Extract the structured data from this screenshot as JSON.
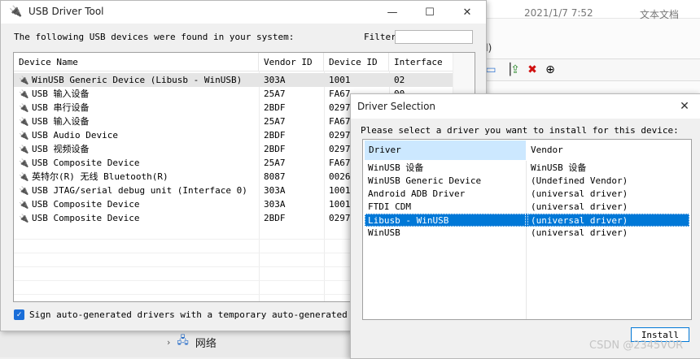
{
  "background": {
    "date_text": "2021/1/7 7:52",
    "type_text": "文本文档",
    "paren_text": "d)",
    "nav_item_label": "网络"
  },
  "usb_tool": {
    "title": "USB Driver Tool",
    "info_text": "The following USB devices were found in your system:",
    "filter_label": "Filter",
    "filter_value": "",
    "columns": [
      "Device Name",
      "Vendor ID",
      "Device ID",
      "Interface"
    ],
    "devices": [
      {
        "name": "WinUSB Generic Device (Libusb - WinUSB)",
        "vendor": "303A",
        "device": "1001",
        "interface": "02",
        "selected": true
      },
      {
        "name": "USB 输入设备",
        "vendor": "25A7",
        "device": "FA67",
        "interface": "00"
      },
      {
        "name": "USB 串行设备",
        "vendor": "2BDF",
        "device": "0297",
        "interface": ""
      },
      {
        "name": "USB 输入设备",
        "vendor": "25A7",
        "device": "FA67",
        "interface": ""
      },
      {
        "name": "USB Audio Device",
        "vendor": "2BDF",
        "device": "0297",
        "interface": ""
      },
      {
        "name": "USB 视频设备",
        "vendor": "2BDF",
        "device": "0297",
        "interface": ""
      },
      {
        "name": "USB Composite Device",
        "vendor": "25A7",
        "device": "FA67",
        "interface": ""
      },
      {
        "name": "英特尔(R) 无线 Bluetooth(R)",
        "vendor": "8087",
        "device": "0026",
        "interface": ""
      },
      {
        "name": "USB JTAG/serial debug unit (Interface 0)",
        "vendor": "303A",
        "device": "1001",
        "interface": ""
      },
      {
        "name": "USB Composite Device",
        "vendor": "303A",
        "device": "1001",
        "interface": ""
      },
      {
        "name": "USB Composite Device",
        "vendor": "2BDF",
        "device": "0297",
        "interface": ""
      }
    ],
    "sign_label": "Sign auto-generated drivers with a temporary auto-generated certi",
    "sign_checked": true
  },
  "driver_selection": {
    "title": "Driver Selection",
    "info_text": "Please select a driver you want to install for this device:",
    "columns": [
      "Driver",
      "Vendor"
    ],
    "drivers": [
      {
        "driver": "WinUSB 设备",
        "vendor": "WinUSB 设备"
      },
      {
        "driver": "WinUSB Generic Device",
        "vendor": "(Undefined Vendor)"
      },
      {
        "driver": "Android ADB Driver",
        "vendor": "(universal driver)"
      },
      {
        "driver": "FTDI CDM",
        "vendor": "(universal driver)"
      },
      {
        "driver": "Libusb - WinUSB",
        "vendor": "(universal driver)",
        "selected": true
      },
      {
        "driver": "WinUSB",
        "vendor": "(universal driver)"
      }
    ],
    "install_label": "Install"
  },
  "watermark": "CSDN @2345VOR",
  "icons": {
    "title_icon": "usb-plug-icon",
    "minimize": "minimize-icon",
    "maximize": "maximize-icon",
    "close": "close-icon",
    "row_icon": "usb-plug-icon",
    "network": "network-icon",
    "chevron": "chevron-right-icon"
  },
  "colors": {
    "selection_blue": "#0078d7",
    "header_highlight": "#cce8ff",
    "checkbox_blue": "#1a6ed8",
    "delete_red": "#d01010",
    "install_green": "#2e8b2e"
  }
}
